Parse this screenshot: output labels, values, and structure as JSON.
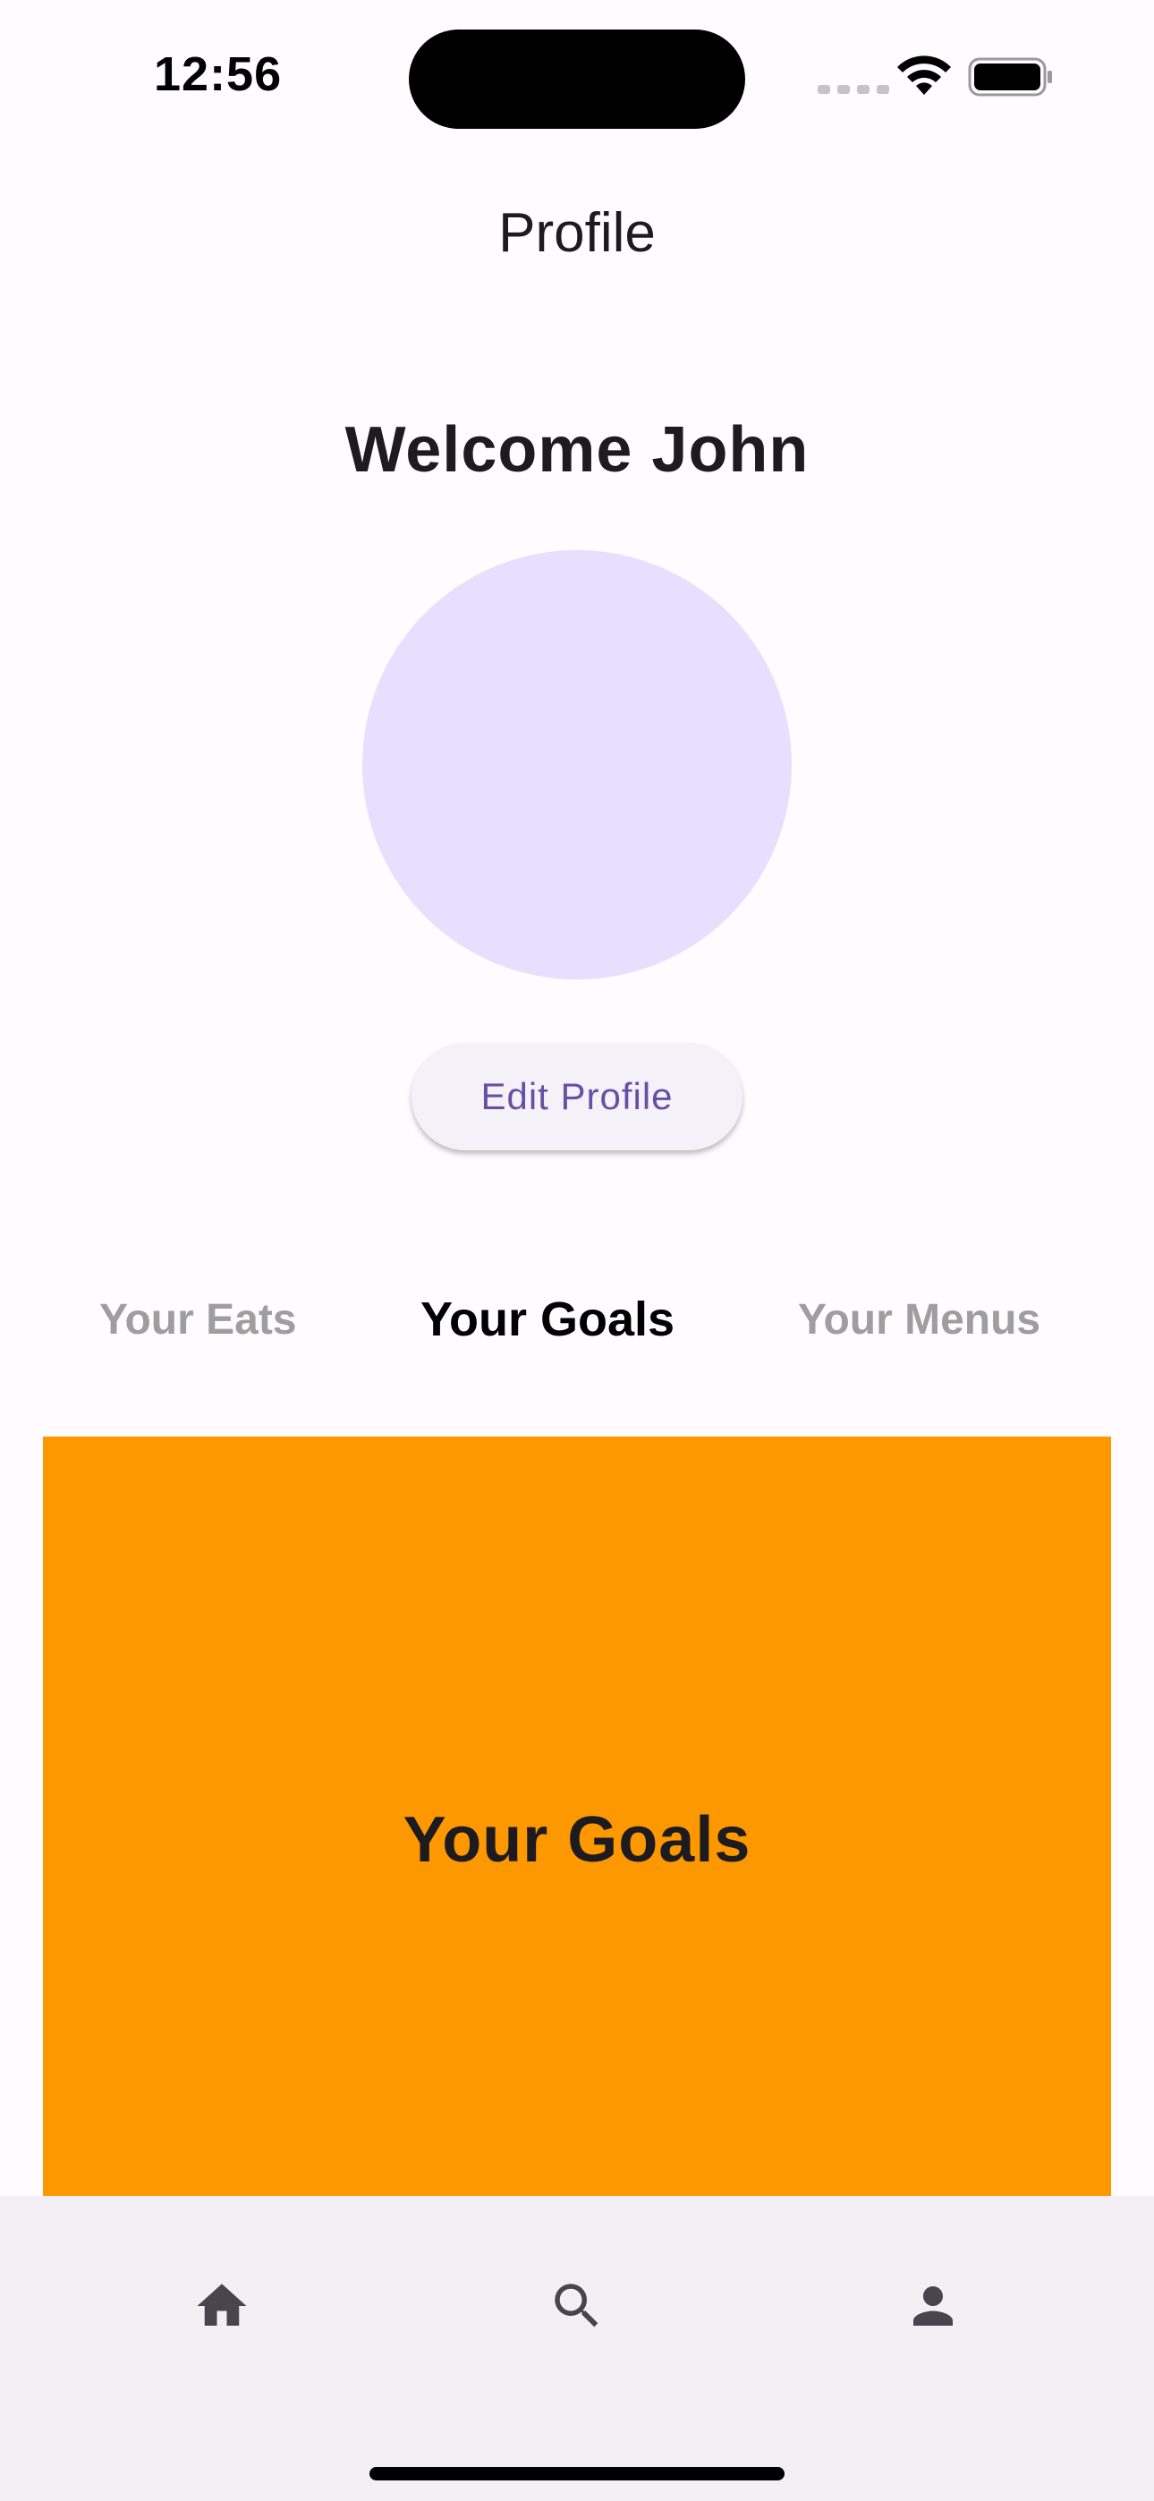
{
  "status_bar": {
    "time": "12:56"
  },
  "app_bar": {
    "title": "Profile"
  },
  "profile": {
    "welcome": "Welcome John",
    "edit_button_label": "Edit Profile"
  },
  "tabs": [
    {
      "label": "Your Eats",
      "selected": false
    },
    {
      "label": "Your Goals",
      "selected": true
    },
    {
      "label": "Your Menus",
      "selected": false
    }
  ],
  "panel": {
    "label": "Your Goals",
    "color": "#fe9800"
  },
  "bottom_nav": {
    "items": [
      {
        "icon": "home-icon"
      },
      {
        "icon": "search-icon"
      },
      {
        "icon": "person-icon"
      }
    ]
  },
  "colors": {
    "accent": "#6750a4",
    "avatar": "#e8defe",
    "background": "#fffbfe",
    "nav_background": "#f3eff4"
  }
}
